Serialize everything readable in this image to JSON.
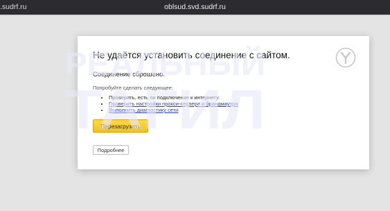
{
  "titlebar": {
    "left_tab": ".sudrf.ru",
    "address": "oblsud.svd.sudrf.ru"
  },
  "error_page": {
    "heading": "Не удаётся установить соединение с сайтом.",
    "subtitle": "Соединение сброшено.",
    "suggestions_label": "Попробуйте сделать следующее:",
    "suggestions": [
      {
        "text": "Проверить, есть ли подключение к интернету.",
        "link": false
      },
      {
        "text": "Проверить настройки прокси-сервера и брандмауэра",
        "link": true
      },
      {
        "text": "Выполнить диагностику сети",
        "link": true
      }
    ],
    "reload_button": "Перезагрузить",
    "details_button": "Подробнее"
  },
  "watermark": {
    "line1": "РЕАЛЬНЫЙ",
    "line2": "ТАГИЛ"
  },
  "logo_icon": "yandex-browser-logo-icon",
  "colors": {
    "titlebar_bg": "#2b2b30",
    "reload_button": "#f5c928",
    "link": "#2a3fc4",
    "watermark": "#e6e8f8"
  }
}
